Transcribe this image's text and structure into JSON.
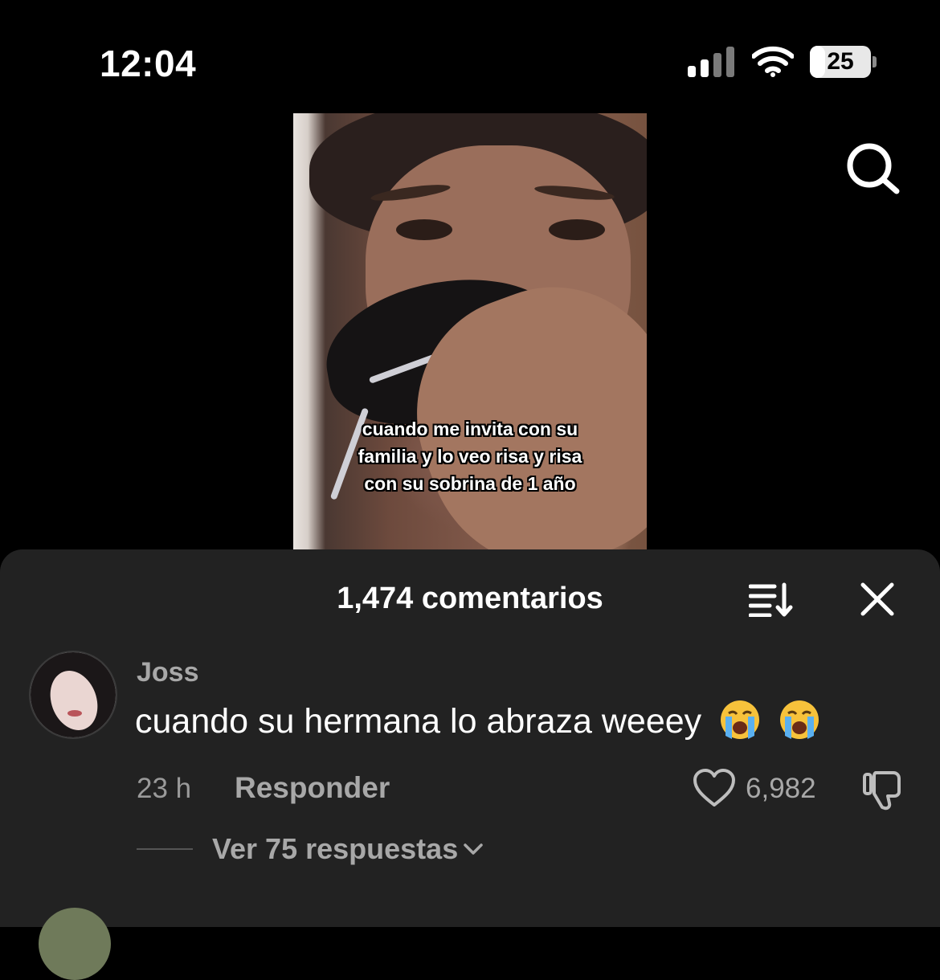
{
  "status_bar": {
    "time": "12:04",
    "battery": "25",
    "battery_level": 0.25
  },
  "video": {
    "caption_lines": [
      "cuando me invita con su",
      "familia y lo veo risa y risa",
      "con su sobrina de 1 año"
    ]
  },
  "comments_sheet": {
    "title": "1,474 comentarios",
    "comment": {
      "username": "Joss",
      "text": "cuando su hermana lo abraza weeey",
      "emojis": [
        "loudly-crying-face",
        "loudly-crying-face"
      ],
      "time": "23 h",
      "reply_label": "Responder",
      "likes": "6,982",
      "view_replies": "Ver 75 respuestas"
    }
  },
  "colors": {
    "sheet_bg": "#222222",
    "muted_text": "#a8a8a8"
  }
}
